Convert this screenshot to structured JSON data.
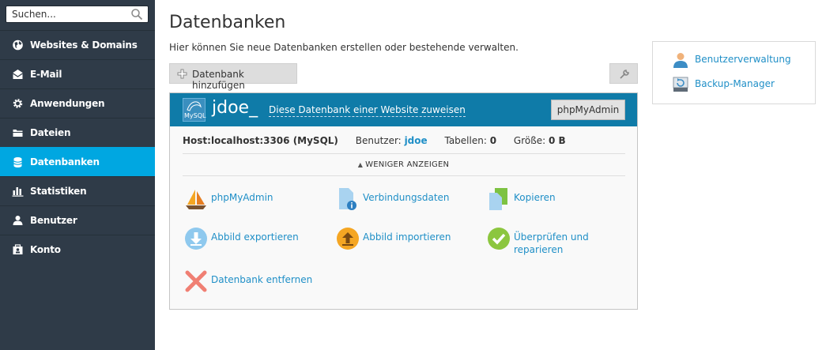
{
  "sidebar": {
    "search": {
      "placeholder": "Suchen..."
    },
    "items": [
      {
        "label": "Websites & Domains",
        "icon": "globe-icon"
      },
      {
        "label": "E-Mail",
        "icon": "envelope-icon"
      },
      {
        "label": "Anwendungen",
        "icon": "gear-icon"
      },
      {
        "label": "Dateien",
        "icon": "folder-icon"
      },
      {
        "label": "Datenbanken",
        "icon": "database-icon",
        "active": true
      },
      {
        "label": "Statistiken",
        "icon": "bar-chart-icon"
      },
      {
        "label": "Benutzer",
        "icon": "user-icon"
      },
      {
        "label": "Konto",
        "icon": "account-icon"
      }
    ]
  },
  "main": {
    "title": "Datenbanken",
    "hint": "Hier können Sie neue Datenbanken erstellen oder bestehende verwalten.",
    "add_button": "Datenbank hinzufügen"
  },
  "database": {
    "icon_text": "MySQL",
    "name": "jdoe_",
    "assign_link": "Diese Datenbank einer Website zuweisen",
    "pma_button": "phpMyAdmin",
    "host": "Host:localhost:3306 (MySQL)",
    "user_label": "Benutzer:",
    "user_value": "jdoe",
    "tables_label": "Tabellen:",
    "tables_value": "0",
    "size_label": "Größe:",
    "size_value": "0 B",
    "less_toggle": "WENIGER ANZEIGEN",
    "actions": [
      {
        "label": "phpMyAdmin",
        "icon": "sailboat-icon"
      },
      {
        "label": "Verbindungsdaten",
        "icon": "document-info-icon"
      },
      {
        "label": "Kopieren",
        "icon": "copy-icon"
      },
      {
        "label": "Abbild exportieren",
        "icon": "download-icon"
      },
      {
        "label": "Abbild importieren",
        "icon": "upload-icon"
      },
      {
        "label": "Überprüfen und reparieren",
        "icon": "check-icon"
      },
      {
        "label": "Datenbank entfernen",
        "icon": "remove-icon"
      }
    ]
  },
  "right_panel": {
    "links": [
      {
        "label": "Benutzerverwaltung",
        "icon": "user-icon"
      },
      {
        "label": "Backup-Manager",
        "icon": "backup-icon"
      }
    ]
  },
  "colors": {
    "sidebar_bg": "#2f3b48",
    "active": "#00a7e1",
    "db_header": "#0f7ba8",
    "link": "#1f8fc7"
  }
}
